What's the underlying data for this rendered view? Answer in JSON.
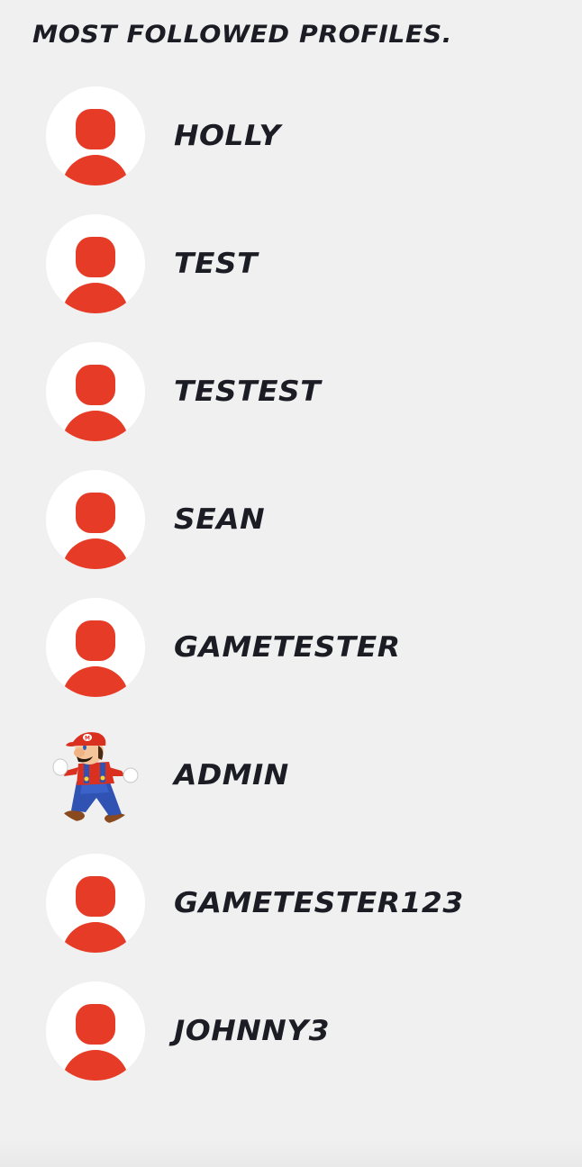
{
  "heading": "MOST FOLLOWED PROFILES.",
  "profiles": [
    {
      "username": "HOLLY",
      "avatar": "default-avatar-icon"
    },
    {
      "username": "TEST",
      "avatar": "default-avatar-icon"
    },
    {
      "username": "TESTEST",
      "avatar": "default-avatar-icon"
    },
    {
      "username": "SEAN",
      "avatar": "default-avatar-icon"
    },
    {
      "username": "GAMETESTER",
      "avatar": "default-avatar-icon"
    },
    {
      "username": "ADMIN",
      "avatar": "mario-character-avatar"
    },
    {
      "username": "GAMETESTER123",
      "avatar": "default-avatar-icon"
    },
    {
      "username": "JOHNNY3",
      "avatar": "default-avatar-icon"
    }
  ],
  "colors": {
    "background": "#f0f0f0",
    "text": "#1c1d24",
    "avatar_accent": "#e63b26",
    "avatar_background": "#ffffff"
  }
}
